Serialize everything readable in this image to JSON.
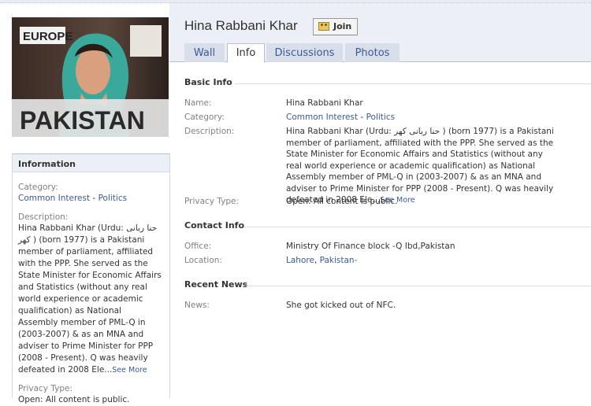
{
  "page": {
    "title": "Hina Rabbani Khar",
    "join_label": "Join",
    "photo_text_top": "EUROPE",
    "photo_text_bottom": "PAKISTAN"
  },
  "tabs": [
    {
      "label": "Wall"
    },
    {
      "label": "Info",
      "active": true
    },
    {
      "label": "Discussions"
    },
    {
      "label": "Photos"
    }
  ],
  "sidebar": {
    "heading": "Information",
    "category_label": "Category:",
    "category_link1": "Common Interest",
    "category_sep": " - ",
    "category_link2": "Politics",
    "description_label": "Description:",
    "description_text": "Hina Rabbani Khar (Urdu: حنا ربانی کھر ) (born 1977) is a Pakistani member of parliament, affiliated with the PPP. She served as the State Minister for Economic Affairs and Statistics (without any real world experience or academic qualification) as National Assembly member of PML-Q in (2003-2007) & as an MNA and adviser to Prime Minister for PPP (2008 - Present). Q was heavily defeated in 2008 Ele...",
    "see_more": "See More",
    "privacy_label": "Privacy Type:",
    "privacy_value": "Open: All content is public."
  },
  "basic_info": {
    "heading": "Basic Info",
    "name_label": "Name:",
    "name_value": "Hina Rabbani Khar",
    "category_label": "Category:",
    "category_link1": "Common Interest",
    "category_sep": " - ",
    "category_link2": "Politics",
    "description_label": "Description:",
    "description_text": "Hina Rabbani Khar (Urdu: حنا ربانی کھر ) (born 1977) is a Pakistani member of parliament, affiliated with the PPP. She served as the State Minister for Economic Affairs and Statistics (without any real world experience or academic qualification) as National Assembly member of PML-Q in (2003-2007) & as an MNA and adviser to Prime Minister for PPP (2008 - Present). Q was heavily defeated in 2008 Ele...",
    "see_more": "See More",
    "privacy_label": "Privacy Type:",
    "privacy_value": "Open: All content is public."
  },
  "contact_info": {
    "heading": "Contact Info",
    "office_label": "Office:",
    "office_value": "Ministry Of Finance block -Q Ibd,Pakistan",
    "location_label": "Location:",
    "location_city": "Lahore",
    "location_sep": ", ",
    "location_country": "Pakistan",
    "location_suffix": "-"
  },
  "recent_news": {
    "heading": "Recent News",
    "news_label": "News:",
    "news_value": "She got kicked out of NFC."
  },
  "colors": {
    "link": "#3b5998",
    "tab_bg": "#d8dfea",
    "header_bg": "#eceff5",
    "label_gray": "#808080"
  }
}
